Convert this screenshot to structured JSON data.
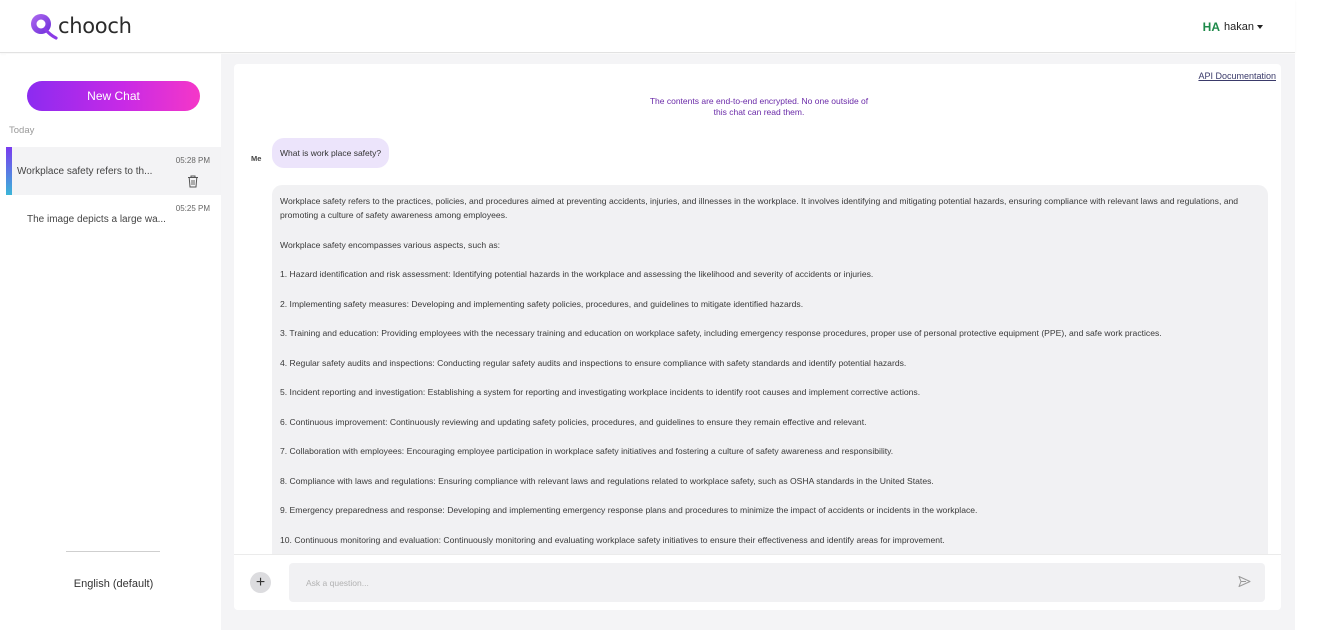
{
  "app": {
    "brand": "chooch",
    "accent_gradient": [
      "#8c2bf0",
      "#f537c8"
    ]
  },
  "header": {
    "user_initials": "HA",
    "user_name": "hakan",
    "icons": [
      "chooch-logo",
      "chevron-down-icon"
    ]
  },
  "sidebar": {
    "new_chat_label": "New Chat",
    "group_label": "Today",
    "chats": [
      {
        "title": "Workplace safety refers to th...",
        "time": "05:28 PM",
        "active": true
      },
      {
        "title": "The image depicts a large wa...",
        "time": "05:25 PM",
        "active": false
      }
    ],
    "language": "English (default)"
  },
  "main": {
    "api_link": "API Documentation",
    "notice_line1": "The contents are end-to-end encrypted. No one outside of",
    "notice_line2": "this chat can read them.",
    "me_label": "Me",
    "question": "What is work place safety?",
    "answer": [
      "Workplace safety refers to the practices, policies, and procedures aimed at preventing accidents, injuries, and illnesses in the workplace. It involves identifying and mitigating potential hazards, ensuring compliance with relevant laws and regulations, and promoting a culture of safety awareness among employees.",
      "Workplace safety encompasses various aspects, such as:",
      "1. Hazard identification and risk assessment: Identifying potential hazards in the workplace and assessing the likelihood and severity of accidents or injuries.",
      "2. Implementing safety measures: Developing and implementing safety policies, procedures, and guidelines to mitigate identified hazards.",
      "3. Training and education: Providing employees with the necessary training and education on workplace safety, including emergency response procedures, proper use of personal protective equipment (PPE), and safe work practices.",
      "4. Regular safety audits and inspections: Conducting regular safety audits and inspections to ensure compliance with safety standards and identify potential hazards.",
      "5. Incident reporting and investigation: Establishing a system for reporting and investigating workplace incidents to identify root causes and implement corrective actions.",
      "6. Continuous improvement: Continuously reviewing and updating safety policies, procedures, and guidelines to ensure they remain effective and relevant.",
      "7. Collaboration with employees: Encouraging employee participation in workplace safety initiatives and fostering a culture of safety awareness and responsibility.",
      "8. Compliance with laws and regulations: Ensuring compliance with relevant laws and regulations related to workplace safety, such as OSHA standards in the United States.",
      "9. Emergency preparedness and response: Developing and implementing emergency response plans and procedures to minimize the impact of accidents or incidents in the workplace.",
      "10. Continuous monitoring and evaluation: Continuously monitoring and evaluating workplace safety initiatives to ensure their effectiveness and identify areas for improvement."
    ],
    "input_placeholder": "Ask a question...",
    "icons": [
      "plus-icon",
      "send-icon",
      "trash-icon"
    ]
  }
}
